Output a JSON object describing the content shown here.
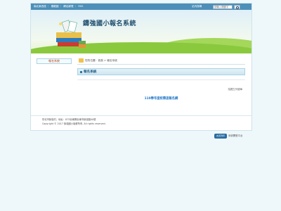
{
  "top_links": [
    "南北東西區",
    "雲龍圖",
    "網站導覽",
    "RSS"
  ],
  "search": {
    "label": "站內搜尋",
    "placeholder": "請輸入關鍵字"
  },
  "site_title": "鑄強國小報名系統",
  "sidebar": {
    "items": [
      {
        "label": "報名系統"
      }
    ]
  },
  "breadcrumb": "您的位置：首頁 > 報名系統",
  "panel": {
    "title": "報名系統",
    "hide_label": "隱藏左列選單",
    "event_link": "110學年度校際盃報名網"
  },
  "footer": {
    "address": "彰化市鑄強村，地址：873臺東縣臺東市鑄強路00號",
    "copyright": "Copyright © 2017 鑄強國小版權所有. All rights reserved."
  },
  "badge": "友善列印",
  "powered": "系統開發平台",
  "colors": {
    "topbar": "#4d8fb8",
    "accent": "#1a73c7",
    "sidebar_text": "#c2410c",
    "hill": "#8ac93e"
  }
}
